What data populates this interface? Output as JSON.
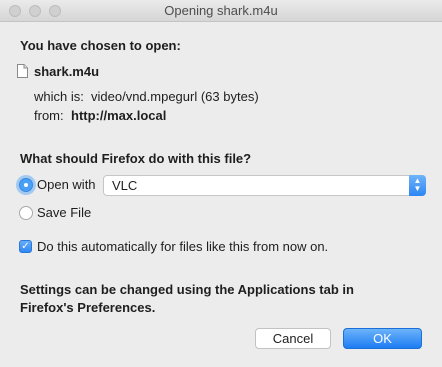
{
  "window": {
    "title": "Opening shark.m4u"
  },
  "intro": {
    "heading": "You have chosen to open:"
  },
  "file": {
    "icon": "document-icon",
    "name": "shark.m4u",
    "which_is_label": "which is:",
    "which_is_value": "video/vnd.mpegurl (63 bytes)",
    "from_label": "from:",
    "from_value": "http://max.local"
  },
  "action": {
    "question": "What should Firefox do with this file?",
    "open_with_label": "Open with",
    "open_with_selected": true,
    "app_selected": "VLC",
    "save_file_label": "Save File",
    "save_file_selected": false
  },
  "auto": {
    "checked": true,
    "label": "Do this automatically for files like this from now on."
  },
  "note": {
    "line1": "Settings can be changed using the Applications tab in",
    "line2": "Firefox's Preferences."
  },
  "buttons": {
    "cancel": "Cancel",
    "ok": "OK"
  },
  "colors": {
    "accent": "#2f88f3",
    "window_bg": "#ececec"
  }
}
